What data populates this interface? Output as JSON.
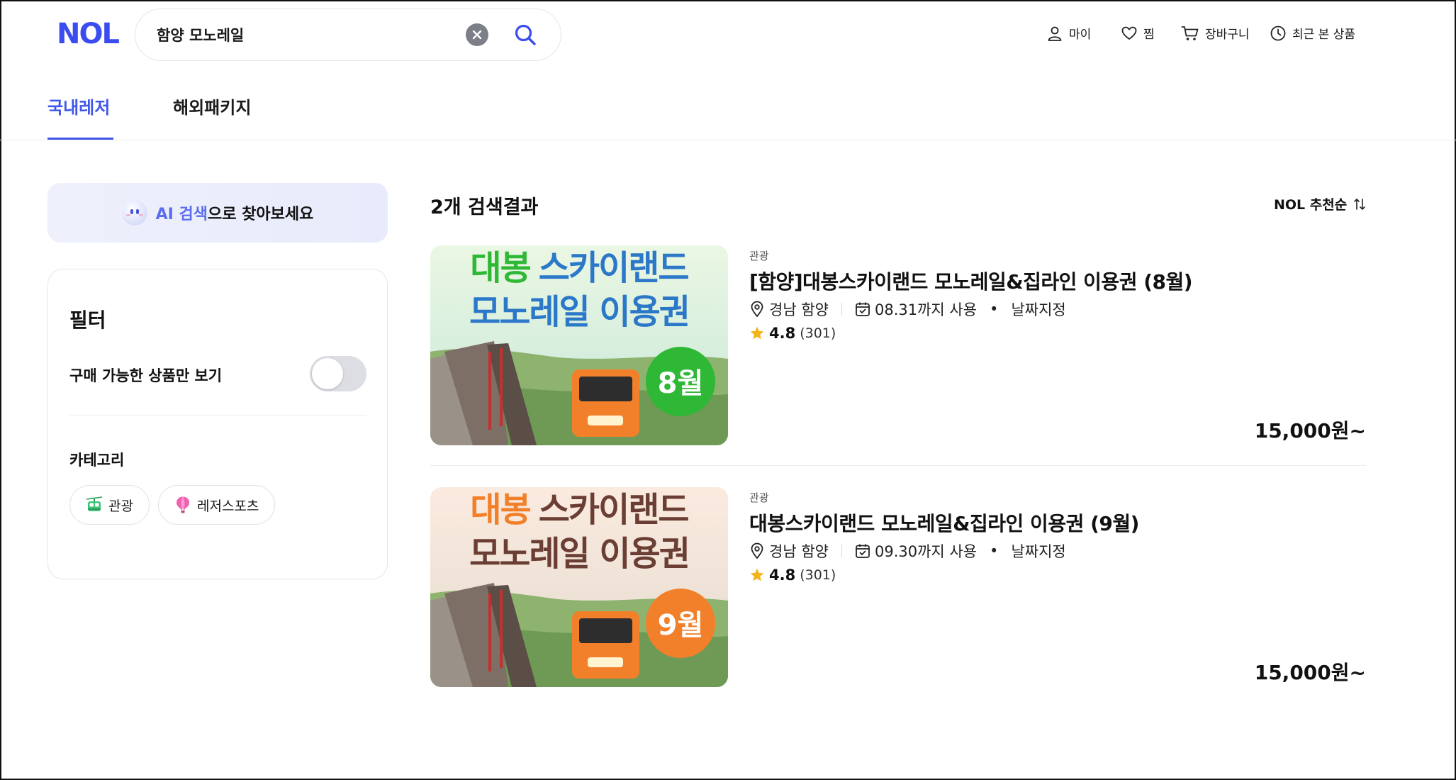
{
  "header": {
    "logo": "NOL",
    "search": {
      "value": "함양 모노레일",
      "placeholder": ""
    },
    "nav": [
      {
        "label": "마이",
        "icon": "user-icon"
      },
      {
        "label": "찜",
        "icon": "heart-icon"
      },
      {
        "label": "장바구니",
        "icon": "cart-icon"
      },
      {
        "label": "최근 본 상품",
        "icon": "clock-icon"
      }
    ]
  },
  "tabs": [
    {
      "label": "국내레저",
      "active": true
    },
    {
      "label": "해외패키지",
      "active": false
    }
  ],
  "sidebar": {
    "ai_banner": {
      "highlight": "AI 검색",
      "rest": "으로 찾아보세요"
    },
    "filter": {
      "title": "필터",
      "available_only_label": "구매 가능한 상품만 보기",
      "available_only_on": false,
      "category_title": "카테고리",
      "categories": [
        {
          "label": "관광",
          "icon": "cable-car-icon"
        },
        {
          "label": "레저스포츠",
          "icon": "hot-air-balloon-icon"
        }
      ]
    }
  },
  "results": {
    "count_label": "2개 검색결과",
    "sort_label": "NOL 추천순",
    "items": [
      {
        "category": "관광",
        "title": "[함양]대봉스카이랜드 모노레일&집라인 이용권 (8월)",
        "location": "경남 함양",
        "validity": "08.31까지 사용",
        "date_type": "날짜지정",
        "rating": "4.8",
        "review_count": "(301)",
        "price": "15,000원~",
        "thumb": {
          "line1_a": "대봉",
          "line1_b": "스카이랜드",
          "line2": "모노레일 이용권",
          "badge": "8월",
          "accent": "#2fb836",
          "line2_color": "#2c78c8",
          "bg_top": "#e6f6df"
        }
      },
      {
        "category": "관광",
        "title": "대봉스카이랜드 모노레일&집라인 이용권 (9월)",
        "location": "경남 함양",
        "validity": "09.30까지 사용",
        "date_type": "날짜지정",
        "rating": "4.8",
        "review_count": "(301)",
        "price": "15,000원~",
        "thumb": {
          "line1_a": "대봉",
          "line1_b": "스카이랜드",
          "line2": "모노레일 이용권",
          "badge": "9월",
          "accent": "#f2802a",
          "line2_color": "#6b3e34",
          "bg_top": "#fbe9dc"
        }
      }
    ]
  },
  "colors": {
    "brand": "#3b4cf0",
    "tab_active": "#3f56e8",
    "star": "#f5b31b"
  }
}
